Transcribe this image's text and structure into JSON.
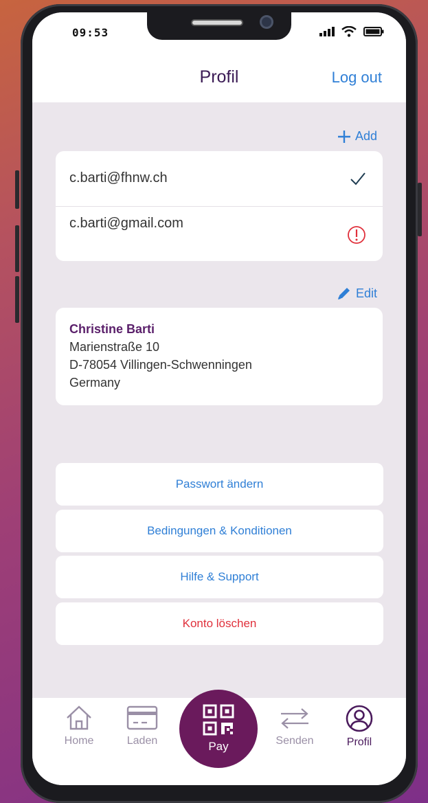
{
  "status_bar": {
    "time": "09:53"
  },
  "header": {
    "title": "Profil",
    "logout_label": "Log out"
  },
  "emails": {
    "add_label": "Add",
    "items": [
      {
        "address": "c.barti@fhnw.ch",
        "state": "verified",
        "icon": "checkmark-icon"
      },
      {
        "address": "c.barti@gmail.com",
        "state": "unverified",
        "icon": "warning-icon"
      }
    ]
  },
  "address": {
    "edit_label": "Edit",
    "name": "Christine Barti",
    "street": "Marienstraße 10",
    "city": "D-78054 Villingen-Schwenningen",
    "country": "Germany"
  },
  "actions": [
    {
      "label": "Passwort ändern"
    },
    {
      "label": "Bedingungen & Konditionen"
    },
    {
      "label": "Hilfe & Support"
    },
    {
      "label": "Konto löschen",
      "danger": true
    }
  ],
  "tabs": {
    "home": "Home",
    "laden": "Laden",
    "pay": "Pay",
    "senden": "Senden",
    "profil": "Profil",
    "active": "profil"
  },
  "colors": {
    "accent": "#2f7fd6",
    "brand": "#6a1a5c",
    "danger": "#e0303b",
    "background": "#ebe6ec"
  }
}
